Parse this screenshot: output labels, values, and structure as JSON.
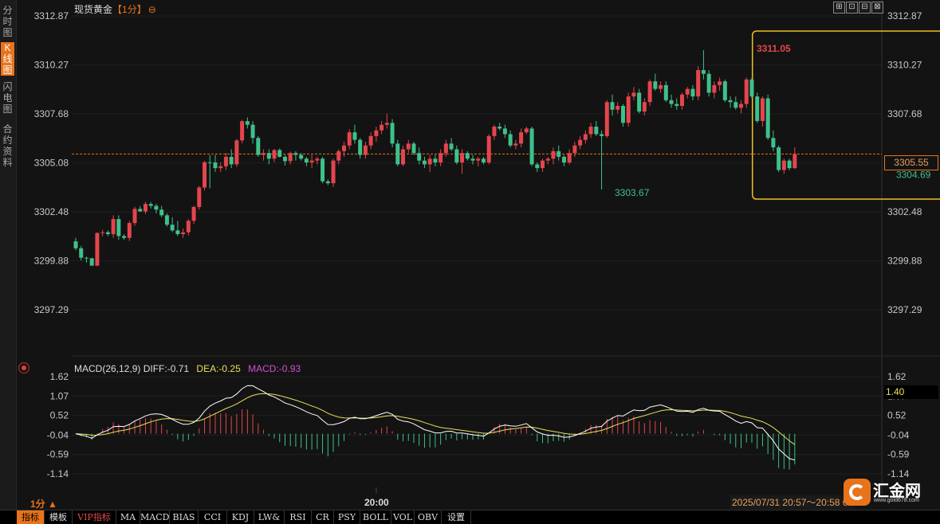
{
  "sidebar": {
    "tabs": [
      {
        "label": "分时图",
        "active": false
      },
      {
        "label": "K线图",
        "active": true
      },
      {
        "label": "闪电图",
        "active": false
      },
      {
        "label": "合约资料",
        "active": false
      }
    ]
  },
  "header": {
    "symbol": "现货黄金",
    "period": "【1分】",
    "toggle_icon": "⊖",
    "window_buttons": [
      "⊞",
      "⊡",
      "⊟",
      "⊠"
    ]
  },
  "macd_header": {
    "label": "MACD(26,12,9)",
    "diff": "DIFF:-0.71",
    "dea": "DEA:-0.25",
    "macd": "MACD:-0.93"
  },
  "price_tag": "3305.55",
  "macd_tag": "1.40",
  "bottom": {
    "period_selector": "1分 ▲",
    "time_label": "20:00",
    "range_label": "2025/07/31 20:57～20:58 60"
  },
  "logo": {
    "name": "汇金网",
    "url": "www.gold678.com"
  },
  "toolbar": [
    {
      "label": "指标",
      "active": true
    },
    {
      "label": "模板"
    },
    {
      "label": "VIP指标",
      "vip": true
    },
    {
      "label": "MA"
    },
    {
      "label": "MACD"
    },
    {
      "label": "BIAS"
    },
    {
      "label": "CCI"
    },
    {
      "label": "KDJ"
    },
    {
      "label": "LW&"
    },
    {
      "label": "RSI"
    },
    {
      "label": "CR"
    },
    {
      "label": "PSY"
    },
    {
      "label": "BOLL"
    },
    {
      "label": "VOL"
    },
    {
      "label": "OBV"
    },
    {
      "label": "设置"
    }
  ],
  "colors": {
    "up": "#e5454d",
    "down": "#3fc08a",
    "accent": "#e9731a",
    "highlight_box": "#f0c020",
    "diff_line": "#ffffff",
    "dea_line": "#e8e05a"
  },
  "chart_data": [
    {
      "type": "candlestick",
      "y_ticks_left": [
        "3312.87",
        "3310.27",
        "3307.68",
        "3305.08",
        "3302.48",
        "3299.88",
        "3297.29"
      ],
      "y_ticks_right": [
        "3312.87",
        "3310.27",
        "3307.68",
        "3305.08",
        "3302.48",
        "3299.88",
        "3297.29"
      ],
      "ylim": [
        3296.0,
        3313.6
      ],
      "x_tick_label": "20:00",
      "current_price": 3305.55,
      "annotations": {
        "high": "3311.05",
        "low": "3303.67",
        "last_low": "3304.69"
      },
      "highlight_range": [
        127,
        184
      ],
      "ohlc": [
        [
          3300.92,
          3301.11,
          3300.44,
          3300.55
        ],
        [
          3300.55,
          3300.68,
          3299.91,
          3300.05
        ],
        [
          3300.05,
          3300.1,
          3299.79,
          3300.02
        ],
        [
          3300.02,
          3300.05,
          3299.62,
          3299.63
        ],
        [
          3299.63,
          3301.4,
          3299.6,
          3301.36
        ],
        [
          3301.36,
          3301.52,
          3301.18,
          3301.4
        ],
        [
          3301.4,
          3301.5,
          3301.2,
          3301.3
        ],
        [
          3301.3,
          3302.3,
          3301.1,
          3302.1
        ],
        [
          3302.1,
          3302.3,
          3301.0,
          3301.2
        ],
        [
          3301.2,
          3301.3,
          3301.0,
          3301.1
        ],
        [
          3301.1,
          3302.0,
          3300.94,
          3301.89
        ],
        [
          3301.89,
          3302.75,
          3301.74,
          3302.64
        ],
        [
          3302.64,
          3302.79,
          3302.49,
          3302.5
        ],
        [
          3302.5,
          3303.02,
          3302.37,
          3302.9
        ],
        [
          3302.9,
          3303.0,
          3302.66,
          3302.8
        ],
        [
          3302.8,
          3302.9,
          3302.4,
          3302.6
        ],
        [
          3302.6,
          3302.8,
          3302.2,
          3302.3
        ],
        [
          3302.3,
          3302.4,
          3301.7,
          3301.8
        ],
        [
          3301.8,
          3302.2,
          3301.4,
          3301.5
        ],
        [
          3301.5,
          3302.0,
          3301.2,
          3301.3
        ],
        [
          3301.3,
          3301.6,
          3301.1,
          3301.4
        ],
        [
          3301.4,
          3302.09,
          3301.23,
          3302.01
        ],
        [
          3302.01,
          3302.8,
          3301.84,
          3302.74
        ],
        [
          3302.74,
          3303.86,
          3302.6,
          3303.77
        ],
        [
          3303.77,
          3305.18,
          3303.62,
          3305.11
        ],
        [
          3305.11,
          3305.49,
          3303.73,
          3305.1
        ],
        [
          3305.1,
          3305.5,
          3304.6,
          3304.8
        ],
        [
          3304.8,
          3305.1,
          3304.6,
          3304.9
        ],
        [
          3304.9,
          3305.6,
          3304.7,
          3305.4
        ],
        [
          3305.4,
          3305.8,
          3304.8,
          3305.0
        ],
        [
          3305.0,
          3306.34,
          3304.87,
          3306.27
        ],
        [
          3306.27,
          3307.37,
          3306.11,
          3307.29
        ],
        [
          3307.29,
          3307.49,
          3306.9,
          3307.1
        ],
        [
          3307.1,
          3307.3,
          3306.1,
          3306.4
        ],
        [
          3306.4,
          3306.5,
          3305.4,
          3305.5
        ],
        [
          3305.5,
          3305.8,
          3305.2,
          3305.6
        ],
        [
          3305.6,
          3305.8,
          3305.0,
          3305.3
        ],
        [
          3305.3,
          3305.82,
          3305.12,
          3305.76
        ],
        [
          3305.76,
          3305.84,
          3305.37,
          3305.4
        ],
        [
          3305.4,
          3305.5,
          3304.94,
          3305.17
        ],
        [
          3305.17,
          3305.67,
          3305.0,
          3305.6
        ],
        [
          3305.6,
          3305.7,
          3305.2,
          3305.5
        ],
        [
          3305.5,
          3305.6,
          3305.2,
          3305.3
        ],
        [
          3305.3,
          3305.4,
          3304.9,
          3305.1
        ],
        [
          3305.1,
          3305.5,
          3304.8,
          3305.2
        ],
        [
          3305.2,
          3305.4,
          3305.0,
          3305.3
        ],
        [
          3305.3,
          3305.4,
          3304.0,
          3304.1
        ],
        [
          3304.1,
          3304.2,
          3303.9,
          3304.0
        ],
        [
          3304.0,
          3305.3,
          3303.8,
          3305.2
        ],
        [
          3305.2,
          3305.8,
          3305.0,
          3305.7
        ],
        [
          3305.7,
          3306.2,
          3305.4,
          3306.0
        ],
        [
          3306.0,
          3306.86,
          3305.8,
          3306.7
        ],
        [
          3306.7,
          3307.1,
          3306.1,
          3306.3
        ],
        [
          3306.3,
          3306.4,
          3305.3,
          3305.5
        ],
        [
          3305.5,
          3306.2,
          3305.3,
          3306.0
        ],
        [
          3306.0,
          3306.7,
          3305.8,
          3306.5
        ],
        [
          3306.5,
          3307.0,
          3306.2,
          3306.8
        ],
        [
          3306.8,
          3307.3,
          3306.6,
          3307.1
        ],
        [
          3307.1,
          3307.7,
          3306.9,
          3307.2
        ],
        [
          3307.2,
          3307.4,
          3305.9,
          3306.1
        ],
        [
          3306.1,
          3306.3,
          3304.9,
          3305.0
        ],
        [
          3305.0,
          3306.0,
          3304.9,
          3305.8
        ],
        [
          3305.8,
          3306.3,
          3305.6,
          3306.1
        ],
        [
          3306.1,
          3306.2,
          3305.5,
          3305.6
        ],
        [
          3305.6,
          3305.9,
          3305.0,
          3305.2
        ],
        [
          3305.2,
          3305.4,
          3304.8,
          3305.0
        ],
        [
          3305.0,
          3305.5,
          3304.6,
          3305.3
        ],
        [
          3305.3,
          3305.5,
          3304.9,
          3305.1
        ],
        [
          3305.1,
          3305.8,
          3304.9,
          3305.6
        ],
        [
          3305.6,
          3306.3,
          3305.4,
          3306.1
        ],
        [
          3306.1,
          3306.4,
          3305.7,
          3305.8
        ],
        [
          3305.8,
          3306.0,
          3305.0,
          3305.1
        ],
        [
          3305.1,
          3305.8,
          3304.5,
          3305.6
        ],
        [
          3305.6,
          3305.7,
          3305.2,
          3305.3
        ],
        [
          3305.3,
          3305.5,
          3305.0,
          3305.2
        ],
        [
          3305.2,
          3305.4,
          3304.9,
          3305.3
        ],
        [
          3305.3,
          3305.4,
          3305.0,
          3305.1
        ],
        [
          3305.1,
          3306.6,
          3305.0,
          3306.5
        ],
        [
          3306.5,
          3307.1,
          3306.3,
          3307.0
        ],
        [
          3307.0,
          3307.2,
          3306.8,
          3306.9
        ],
        [
          3306.9,
          3307.1,
          3306.4,
          3306.6
        ],
        [
          3306.6,
          3306.8,
          3305.9,
          3306.0
        ],
        [
          3306.0,
          3306.3,
          3305.8,
          3306.1
        ],
        [
          3306.1,
          3306.9,
          3305.9,
          3306.7
        ],
        [
          3306.7,
          3307.0,
          3306.6,
          3306.9
        ],
        [
          3306.9,
          3307.0,
          3304.9,
          3305.0
        ],
        [
          3305.0,
          3305.1,
          3304.6,
          3304.8
        ],
        [
          3304.8,
          3305.3,
          3304.6,
          3305.2
        ],
        [
          3305.2,
          3305.4,
          3305.0,
          3305.3
        ],
        [
          3305.3,
          3305.9,
          3305.0,
          3305.7
        ],
        [
          3305.7,
          3306.0,
          3305.2,
          3305.4
        ],
        [
          3305.4,
          3305.5,
          3304.9,
          3305.1
        ],
        [
          3305.1,
          3305.8,
          3305.0,
          3305.6
        ],
        [
          3305.6,
          3306.2,
          3305.4,
          3306.0
        ],
        [
          3306.0,
          3306.5,
          3305.8,
          3306.3
        ],
        [
          3306.3,
          3306.8,
          3306.1,
          3306.6
        ],
        [
          3306.6,
          3307.2,
          3306.4,
          3307.0
        ],
        [
          3307.0,
          3307.3,
          3306.5,
          3306.6
        ],
        [
          3306.6,
          3306.8,
          3303.67,
          3306.5
        ],
        [
          3306.5,
          3308.4,
          3306.4,
          3308.3
        ],
        [
          3308.3,
          3308.7,
          3307.6,
          3307.9
        ],
        [
          3307.9,
          3308.3,
          3307.7,
          3308.1
        ],
        [
          3308.1,
          3308.2,
          3307.0,
          3307.2
        ],
        [
          3307.2,
          3308.8,
          3307.0,
          3308.6
        ],
        [
          3308.6,
          3309.1,
          3308.4,
          3308.8
        ],
        [
          3308.8,
          3309.0,
          3307.7,
          3307.8
        ],
        [
          3307.8,
          3308.5,
          3307.6,
          3308.3
        ],
        [
          3308.3,
          3309.5,
          3308.1,
          3309.4
        ],
        [
          3309.4,
          3309.8,
          3308.9,
          3309.0
        ],
        [
          3309.0,
          3309.4,
          3308.8,
          3309.2
        ],
        [
          3309.2,
          3309.4,
          3308.3,
          3308.4
        ],
        [
          3308.4,
          3308.7,
          3308.0,
          3308.2
        ],
        [
          3308.2,
          3308.5,
          3307.9,
          3308.1
        ],
        [
          3308.1,
          3308.8,
          3307.9,
          3308.7
        ],
        [
          3308.7,
          3309.1,
          3308.5,
          3309.0
        ],
        [
          3309.0,
          3309.2,
          3308.4,
          3308.6
        ],
        [
          3308.6,
          3310.2,
          3308.4,
          3310.0
        ],
        [
          3310.0,
          3311.05,
          3309.5,
          3309.8
        ],
        [
          3309.8,
          3310.0,
          3308.6,
          3308.8
        ],
        [
          3308.8,
          3309.4,
          3308.5,
          3309.2
        ],
        [
          3309.2,
          3309.6,
          3308.9,
          3309.4
        ],
        [
          3309.4,
          3309.5,
          3308.3,
          3308.4
        ],
        [
          3308.4,
          3308.6,
          3308.0,
          3308.3
        ],
        [
          3308.3,
          3308.6,
          3307.9,
          3308.0
        ],
        [
          3308.0,
          3308.4,
          3307.7,
          3308.2
        ],
        [
          3308.2,
          3309.6,
          3308.0,
          3309.5
        ],
        [
          3309.5,
          3309.6,
          3308.5,
          3308.6
        ],
        [
          3308.6,
          3308.8,
          3307.2,
          3307.3
        ],
        [
          3307.3,
          3308.6,
          3307.0,
          3308.5
        ],
        [
          3308.5,
          3308.7,
          3306.3,
          3306.4
        ],
        [
          3306.4,
          3306.8,
          3305.7,
          3305.9
        ],
        [
          3305.9,
          3306.0,
          3304.6,
          3304.7
        ],
        [
          3304.7,
          3305.3,
          3304.5,
          3305.2
        ],
        [
          3305.2,
          3305.3,
          3304.69,
          3304.8
        ],
        [
          3304.8,
          3305.9,
          3304.75,
          3305.55
        ]
      ]
    },
    {
      "type": "macd",
      "params": "26,12,9",
      "y_ticks": [
        "1.62",
        "1.07",
        "0.52",
        "-0.04",
        "-0.59",
        "-1.14"
      ],
      "ylim": [
        -1.44,
        1.87
      ],
      "diff_last": -0.71,
      "dea_last": -0.25,
      "macd_last": -0.93
    }
  ]
}
